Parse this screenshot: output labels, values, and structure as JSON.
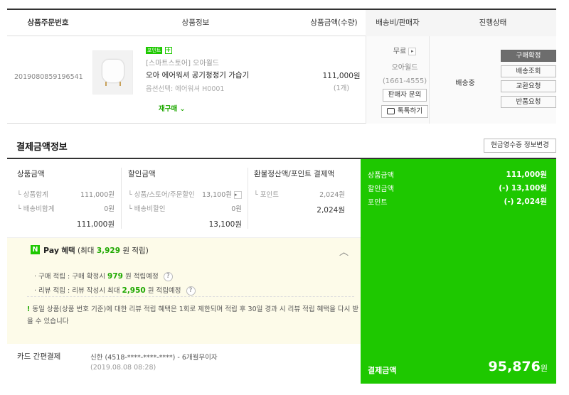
{
  "order_table": {
    "headers": {
      "order_no": "상품주문번호",
      "product_info": "상품정보",
      "price_qty": "상품금액(수량)",
      "shipping_seller": "배송비/판매자",
      "status": "진행상태"
    },
    "item": {
      "order_no": "2019080859196541",
      "point_badge": "포인트",
      "point_plus": "+",
      "store": "[스마트스토어] 오아월드",
      "name": "오아 에어워셔 공기청정기 가습기",
      "option": "옵션선택: 에어워셔 H0001",
      "rebuy": "재구매",
      "rebuy_caret": "⌄",
      "price": "111,000원",
      "qty": "(1개)",
      "shipping_fee": "무료",
      "arrow": "▸",
      "seller": "오아월드",
      "seller_tel": "(1661-4555)",
      "seller_inquiry_btn": "판매자 문의",
      "talk_btn": "톡톡하기",
      "delivery_status": "배송중",
      "status_buttons": [
        "구매확정",
        "배송조회",
        "교환요청",
        "반품요청"
      ]
    }
  },
  "payment": {
    "title": "결제금액정보",
    "receipt_btn": "현금영수증 정보변경",
    "product_amount": {
      "title": "상품금액",
      "rows": [
        {
          "label": "└ 상품합계",
          "value": "111,000원"
        },
        {
          "label": "└ 배송비합계",
          "value": "0원"
        }
      ],
      "total": "111,000원"
    },
    "discount": {
      "title": "할인금액",
      "rows": [
        {
          "label": "└ 상품/스토어/주문할인",
          "value": "13,100원"
        },
        {
          "label": "└ 배송비할인",
          "value": "0원"
        }
      ],
      "total": "13,100원",
      "arrow": "▸"
    },
    "refund_point": {
      "title": "환불정산액/포인트 결제액",
      "rows": [
        {
          "label": "└ 포인트",
          "value": "2,024원"
        }
      ],
      "total": "2,024원"
    },
    "npay": {
      "n": "N",
      "pay": "Pay",
      "benefit": "혜택",
      "max_prefix": "(최대",
      "max_value": "3,929",
      "max_suffix": "원 적립)",
      "caret": "︿",
      "purchase_prefix": "· 구매 적립 : 구매 확정시",
      "purchase_value": "979",
      "purchase_suffix": "원 적립예정",
      "review_prefix": "· 리뷰 적립 : 리뷰 작성시 최대",
      "review_value": "2,950",
      "review_suffix": "원 적립예정",
      "qmark": "?",
      "notice_ex": "!",
      "notice": "동일 상품(상품 번호 기준)에 대한 리뷰 적립 혜택은 1회로 제한되며 적립 후 30일 경과 시 리뷰 적립 혜택을 다시 받을 수 있습니다"
    },
    "card": {
      "label": "카드 간편결제",
      "info": "신한 (4518-****-****-****) - 6개월무이자",
      "date": "(2019.08.08 08:28)"
    },
    "summary": {
      "rows": [
        {
          "label": "상품금액",
          "value": "111,000원"
        },
        {
          "label": "할인금액",
          "value": "(-) 13,100원"
        },
        {
          "label": "포인트",
          "value": "(-) 2,024원"
        }
      ],
      "final_label": "결제금액",
      "final_value": "95,876",
      "final_unit": "원"
    },
    "colors": {
      "accent_green": "#1ec800",
      "text_green": "#1ea800",
      "npay_bg": "#fdfbe9"
    }
  }
}
